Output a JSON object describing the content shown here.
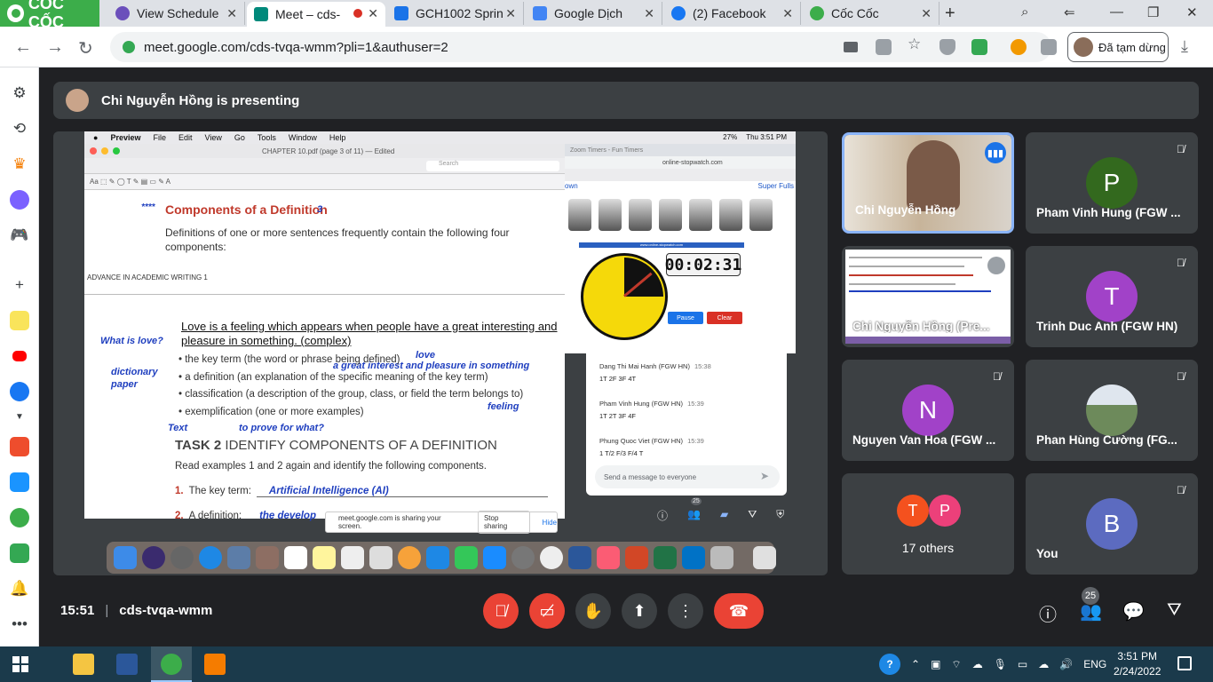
{
  "browser": {
    "brand": "CỐC CỐC",
    "tabs": [
      {
        "label": "View Schedule",
        "color": "#6b4fbb"
      },
      {
        "label": "Meet – cds-",
        "color": "#00897b"
      },
      {
        "label": "GCH1002 Sprin",
        "color": "#1a73e8"
      },
      {
        "label": "Google Dịch",
        "color": "#4285f4"
      },
      {
        "label": "(2) Facebook",
        "color": "#1877f2"
      },
      {
        "label": "Cốc Cốc",
        "color": "#3cad4a"
      }
    ],
    "url": "meet.google.com/cds-tvqa-wmm?pli=1&authuser=2",
    "profile_status": "Đã tạm dừng"
  },
  "meet": {
    "presenting_text": "Chi Nguyễn Hồng is presenting",
    "meeting_time": "15:51",
    "meeting_code": "cds-tvqa-wmm",
    "people_count": "25",
    "shared_screen": {
      "mac_menu": [
        "Preview",
        "File",
        "Edit",
        "View",
        "Go",
        "Tools",
        "Window",
        "Help"
      ],
      "mac_status_time": "Thu 3:51 PM",
      "mac_status_battery": "27%",
      "preview_title": "CHAPTER 10.pdf (page 3 of 11) — Edited",
      "preview_search_placeholder": "Search",
      "page1": {
        "stars": "****",
        "heading": "Components of a Definition",
        "heading_num": "3",
        "body": "Definitions of one or more sentences frequently contain the following four components:",
        "footer": "ADVANCE IN ACADEMIC WRITING 1"
      },
      "page2": {
        "note_what": "What is love?",
        "answer": "Love is a feeling which appears when people have a great interesting and pleasure in something. (complex)",
        "note_love": "love",
        "note_interest": "a great interest and pleasure in something",
        "note_dictionary": "dictionary paper",
        "bullet1": "the key term (the word or phrase being defined)",
        "bullet2": "a definition (an explanation of the specific meaning of the key term)",
        "bullet3": "classification (a description of the group, class, or field the term belongs to)",
        "bullet4": "exemplification (one or more examples)",
        "note_feeling": "feeling",
        "note_text": "Text",
        "note_prove": "to prove for what?",
        "task_label": "TASK 2",
        "task_title": "IDENTIFY COMPONENTS OF A DEFINITION",
        "task_body": "Read examples 1 and 2 again and identify the following components.",
        "q1_num": "1.",
        "q1_label": "The key term:",
        "q1_answer": "Artificial Intelligence (AI)",
        "q2_num": "2.",
        "q2_label": "A definition:",
        "q2_answer": "the develop"
      },
      "stopwatch": {
        "tab": "Zoom Timers - Fun Timers",
        "url": "online-stopwatch.com",
        "link_left": "own",
        "link_right": "Super Fulls",
        "site_banner": "www.online-stopwatch.com",
        "time": "00:02:31",
        "pause_label": "Pause",
        "clear_label": "Clear"
      },
      "chat": [
        {
          "who": "Dang Thi Mai Hanh (FGW HN)",
          "when": "15:38",
          "text": "1T 2F 3F 4T"
        },
        {
          "who": "Pham Vinh Hung (FGW HN)",
          "when": "15:39",
          "text": "1T 2T 3F 4F"
        },
        {
          "who": "Phung Quoc Viet (FGW HN)",
          "when": "15:39",
          "text": "1 T/2 F/3 F/4 T"
        }
      ],
      "chat_placeholder": "Send a message to everyone",
      "share_notice": "meet.google.com is sharing your screen.",
      "share_stop": "Stop sharing",
      "share_hide": "Hide",
      "mini_people_badge": "25"
    },
    "participants": [
      {
        "name": "Chi Nguyễn Hồng",
        "initial": "",
        "color": "#c9a48a",
        "muted": false
      },
      {
        "name": "Pham Vinh Hung (FGW ...",
        "initial": "P",
        "color": "#33691e",
        "muted": true
      },
      {
        "name": "Chi Nguyễn Hồng (Pre...",
        "initial": "",
        "color": "#ffffff",
        "muted": true
      },
      {
        "name": "Trinh Duc Anh (FGW HN)",
        "initial": "T",
        "color": "#a142c8",
        "muted": true
      },
      {
        "name": "Nguyen Van Hoa (FGW ...",
        "initial": "N",
        "color": "#a142c8",
        "muted": true
      },
      {
        "name": "Phan Hùng Cường (FG...",
        "initial": "",
        "color": "#6d8a5b",
        "muted": true
      },
      {
        "name": "17 others",
        "initial": "",
        "color": "#3c4043",
        "muted": false
      },
      {
        "name": "You",
        "initial": "B",
        "color": "#5c6bc0",
        "muted": true
      }
    ],
    "others_avatars": [
      {
        "initial": "T",
        "color": "#f4511e"
      },
      {
        "initial": "P",
        "color": "#ec407a"
      }
    ]
  },
  "taskbar": {
    "language": "ENG",
    "time": "3:51 PM",
    "date": "2/24/2022"
  }
}
